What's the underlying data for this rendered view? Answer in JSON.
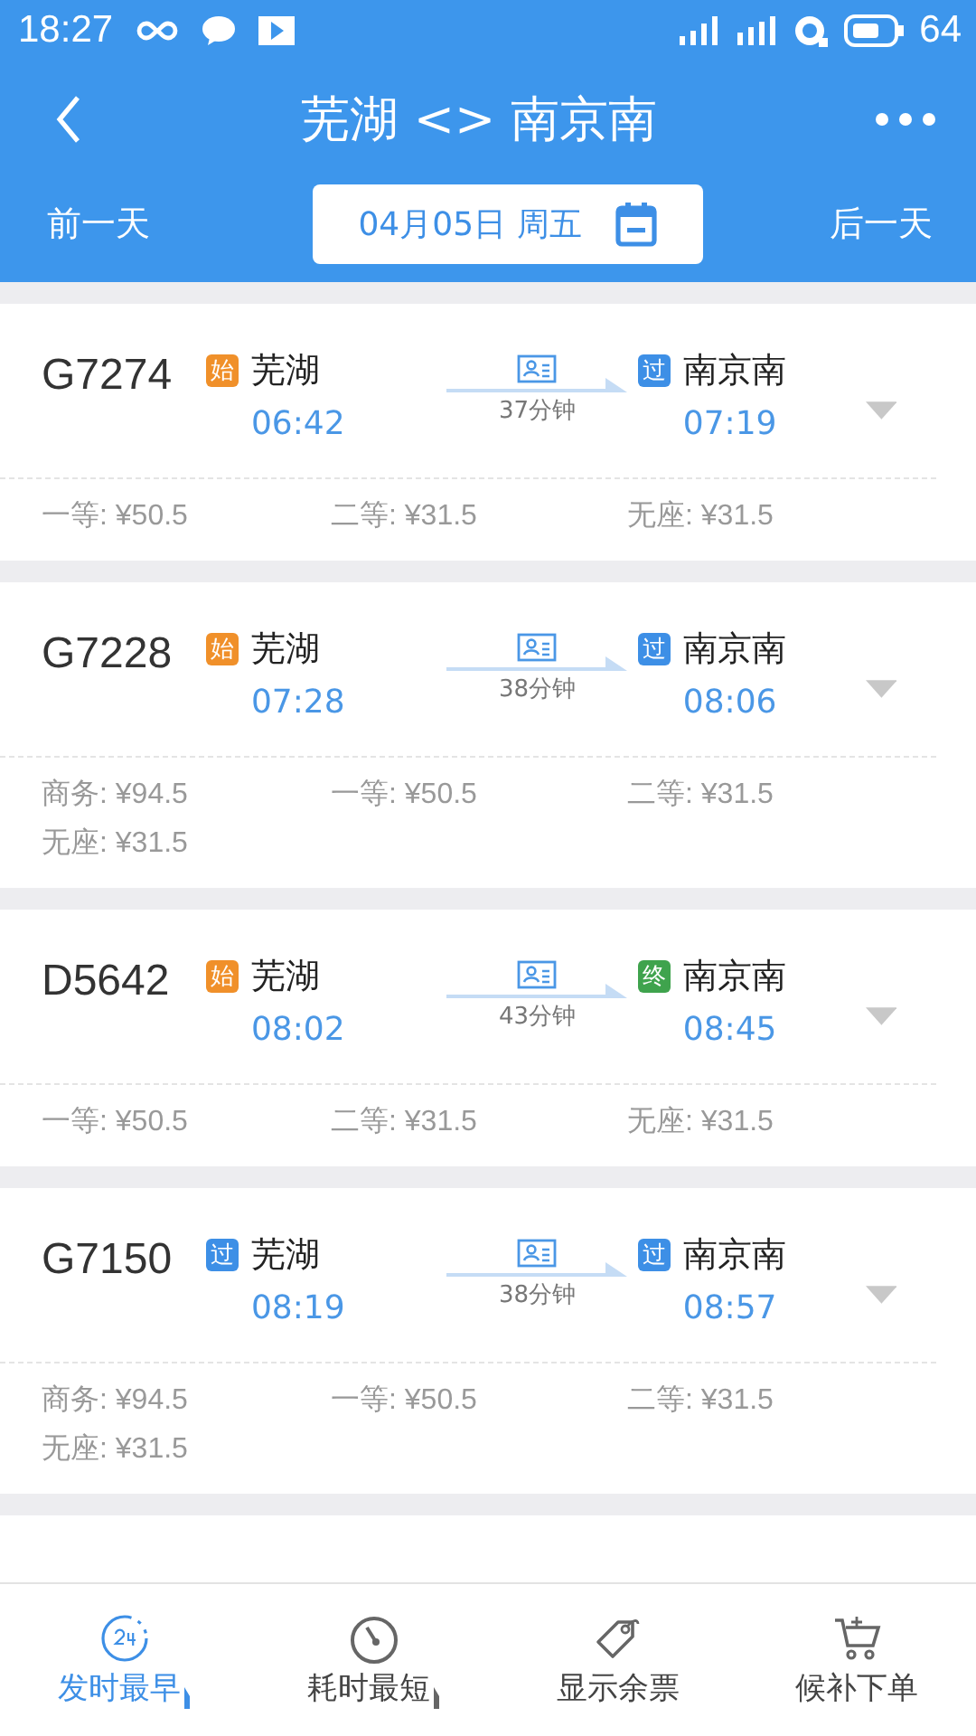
{
  "status_bar": {
    "time": "18:27",
    "battery": "64"
  },
  "header": {
    "title": "芜湖 <> 南京南"
  },
  "date_bar": {
    "prev": "前一天",
    "date": "04月05日 周五",
    "next": "后一天"
  },
  "trains": [
    {
      "number": "G7274",
      "from_badge": {
        "text": "始",
        "color": "#f0902a"
      },
      "from": "芜湖",
      "depart": "06:42",
      "duration": "37分钟",
      "to_badge": {
        "text": "过",
        "color": "#3d8fe6"
      },
      "to": "南京南",
      "arrive": "07:19",
      "prices": [
        "一等: ¥50.5",
        "二等: ¥31.5",
        "无座: ¥31.5"
      ]
    },
    {
      "number": "G7228",
      "from_badge": {
        "text": "始",
        "color": "#f0902a"
      },
      "from": "芜湖",
      "depart": "07:28",
      "duration": "38分钟",
      "to_badge": {
        "text": "过",
        "color": "#3d8fe6"
      },
      "to": "南京南",
      "arrive": "08:06",
      "prices": [
        "商务: ¥94.5",
        "一等: ¥50.5",
        "二等: ¥31.5",
        "无座: ¥31.5"
      ]
    },
    {
      "number": "D5642",
      "from_badge": {
        "text": "始",
        "color": "#f0902a"
      },
      "from": "芜湖",
      "depart": "08:02",
      "duration": "43分钟",
      "to_badge": {
        "text": "终",
        "color": "#3fa34d"
      },
      "to": "南京南",
      "arrive": "08:45",
      "prices": [
        "一等: ¥50.5",
        "二等: ¥31.5",
        "无座: ¥31.5"
      ]
    },
    {
      "number": "G7150",
      "from_badge": {
        "text": "过",
        "color": "#3d8fe6"
      },
      "from": "芜湖",
      "depart": "08:19",
      "duration": "38分钟",
      "to_badge": {
        "text": "过",
        "color": "#3d8fe6"
      },
      "to": "南京南",
      "arrive": "08:57",
      "prices": [
        "商务: ¥94.5",
        "一等: ¥50.5",
        "二等: ¥31.5",
        "无座: ¥31.5"
      ]
    }
  ],
  "bottom_tabs": [
    {
      "label": "发时最早",
      "kind": "clock24",
      "selected": true,
      "sort_indicator": true
    },
    {
      "label": "耗时最短",
      "kind": "timer",
      "selected": false,
      "sort_indicator": true
    },
    {
      "label": "显示余票",
      "kind": "tag",
      "selected": false,
      "sort_indicator": false
    },
    {
      "label": "候补下单",
      "kind": "cart",
      "selected": false,
      "sort_indicator": false
    }
  ]
}
